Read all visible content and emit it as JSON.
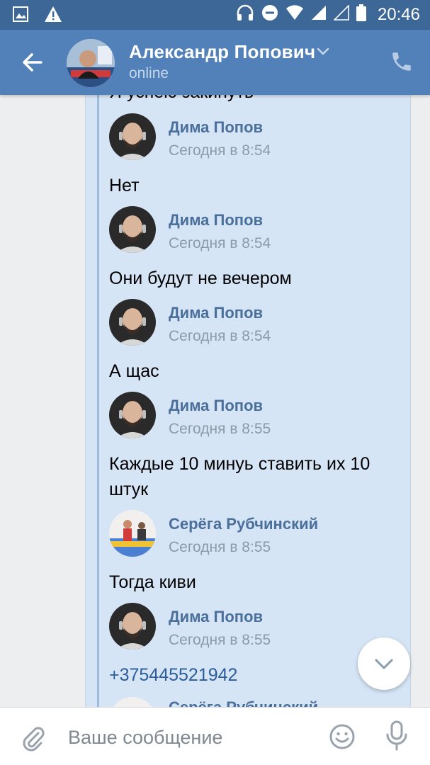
{
  "status_bar": {
    "time": "20:46",
    "left_icons": [
      "gallery-icon",
      "warning-icon"
    ],
    "right_icons": [
      "headphones-icon",
      "do-not-disturb-icon",
      "wifi-icon",
      "signal-icon",
      "signal-empty-icon",
      "battery-icon"
    ]
  },
  "header": {
    "contact_name": "Александр Попович",
    "status": "online",
    "accent_color": "#5181b8"
  },
  "forwarded": {
    "cut_text": "Я успею закинуть",
    "messages": [
      {
        "author": "Дима Попов",
        "time": "Сегодня в 8:54",
        "text": "Нет"
      },
      {
        "author": "Дима Попов",
        "time": "Сегодня в 8:54",
        "text": "Они будут не вечером"
      },
      {
        "author": "Дима Попов",
        "time": "Сегодня в 8:54",
        "text": "А щас"
      },
      {
        "author": "Дима Попов",
        "time": "Сегодня в 8:55",
        "text": "Каждые  10 минуь ставить  их 10 штук"
      },
      {
        "author": "Серёга Рубчинский",
        "time": "Сегодня в 8:55",
        "text": "Тогда киви"
      },
      {
        "author": "Дима Попов",
        "time": "Сегодня в 8:55",
        "text": "+375445521942"
      },
      {
        "author": "Серёга Рубчинский"
      }
    ]
  },
  "composer": {
    "placeholder": "Ваше сообщение",
    "value": ""
  }
}
